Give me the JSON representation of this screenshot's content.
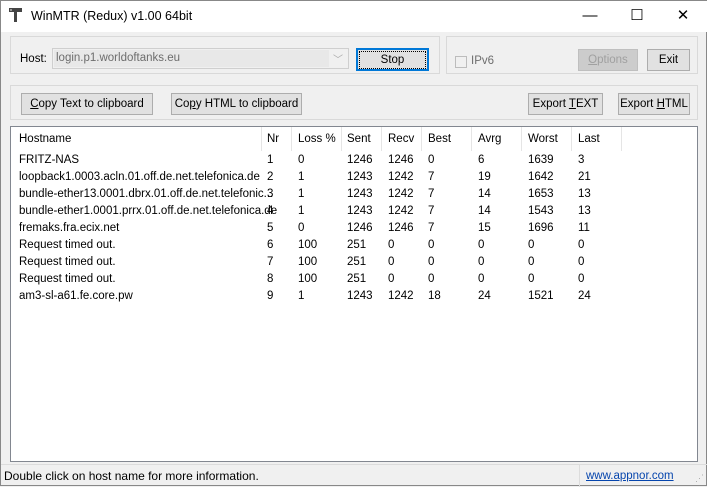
{
  "window": {
    "title": "WinMTR (Redux) v1.00 64bit",
    "minimize": "—",
    "maximize": "☐",
    "close": "✕"
  },
  "host": {
    "label": "Host:",
    "value": "login.p1.worldoftanks.eu",
    "stop_label": "Stop"
  },
  "options": {
    "ipv6_label": "IPv6",
    "ipv6_checked": false,
    "options_label": "Options",
    "options_accel": "O",
    "exit_label": "Exit"
  },
  "toolbar": {
    "copy_text": {
      "pre": "",
      "accel": "C",
      "post": "opy Text to clipboard"
    },
    "copy_html": {
      "pre": "Co",
      "accel": "p",
      "post": "y HTML to clipboard"
    },
    "export_text": {
      "pre": "Export ",
      "accel": "T",
      "post": "EXT"
    },
    "export_html": {
      "pre": "Export ",
      "accel": "H",
      "post": "TML"
    }
  },
  "table": {
    "columns": [
      "Hostname",
      "Nr",
      "Loss %",
      "Sent",
      "Recv",
      "Best",
      "Avrg",
      "Worst",
      "Last"
    ],
    "rows": [
      [
        "FRITZ-NAS",
        "1",
        "0",
        "1246",
        "1246",
        "0",
        "6",
        "1639",
        "3"
      ],
      [
        "loopback1.0003.acln.01.off.de.net.telefonica.de",
        "2",
        "1",
        "1243",
        "1242",
        "7",
        "19",
        "1642",
        "21"
      ],
      [
        "bundle-ether13.0001.dbrx.01.off.de.net.telefonic...",
        "3",
        "1",
        "1243",
        "1242",
        "7",
        "14",
        "1653",
        "13"
      ],
      [
        "bundle-ether1.0001.prrx.01.off.de.net.telefonica.de",
        "4",
        "1",
        "1243",
        "1242",
        "7",
        "14",
        "1543",
        "13"
      ],
      [
        "fremaks.fra.ecix.net",
        "5",
        "0",
        "1246",
        "1246",
        "7",
        "15",
        "1696",
        "11"
      ],
      [
        "Request timed out.",
        "6",
        "100",
        "251",
        "0",
        "0",
        "0",
        "0",
        "0"
      ],
      [
        "Request timed out.",
        "7",
        "100",
        "251",
        "0",
        "0",
        "0",
        "0",
        "0"
      ],
      [
        "Request timed out.",
        "8",
        "100",
        "251",
        "0",
        "0",
        "0",
        "0",
        "0"
      ],
      [
        "am3-sl-a61.fe.core.pw",
        "9",
        "1",
        "1243",
        "1242",
        "18",
        "24",
        "1521",
        "24"
      ]
    ]
  },
  "status": {
    "message": "Double click on host name for more information.",
    "link": "www.appnor.com"
  },
  "colors": {
    "accent": "#0078d7",
    "link": "#0645ad"
  }
}
